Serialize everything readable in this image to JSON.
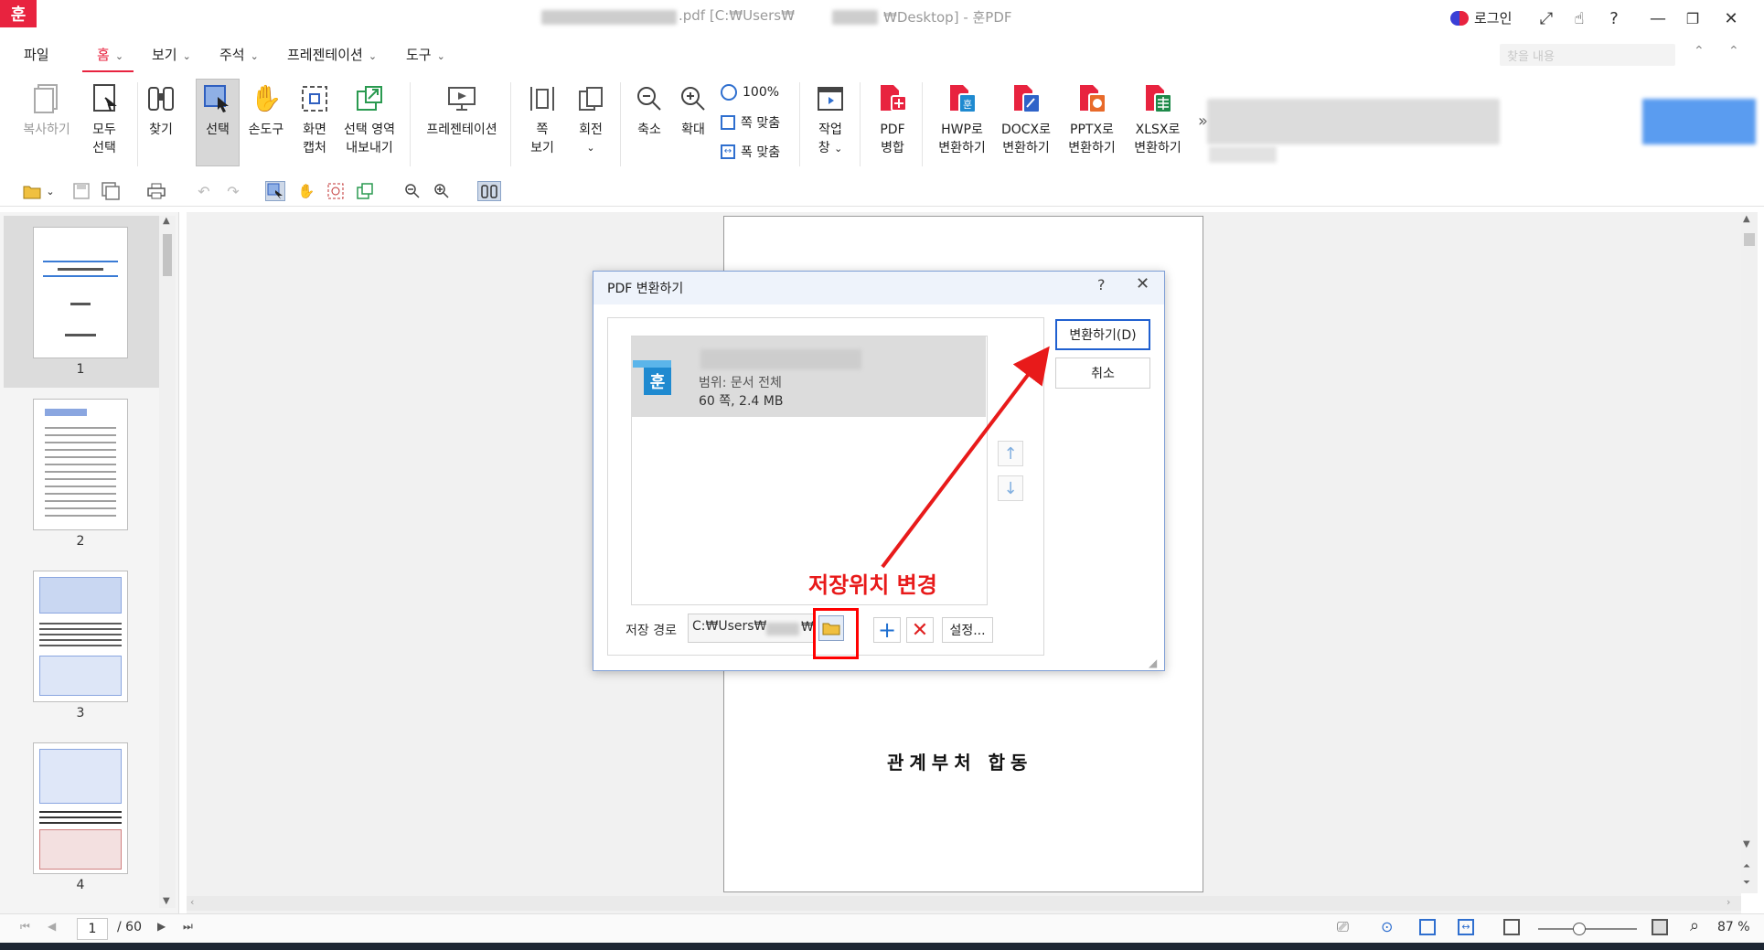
{
  "titlebar": {
    "logo": "훈",
    "file_suffix": ".pdf",
    "path_part1": "[C:₩Users₩",
    "path_part2": "₩Desktop]",
    "app_sep": " - ",
    "app_name": "훈PDF",
    "login": "로그인"
  },
  "menu": {
    "file": "파일",
    "home": "홈",
    "view": "보기",
    "annotation": "주석",
    "presentation": "프레젠테이션",
    "tools": "도구",
    "search_placeholder": "찾을 내용"
  },
  "ribbon": {
    "copy": "복사하기",
    "select_all_1": "모두",
    "select_all_2": "선택",
    "find": "찾기",
    "select": "선택",
    "hand": "손도구",
    "capture_1": "화면",
    "capture_2": "캡처",
    "export_1": "선택 영역",
    "export_2": "내보내기",
    "presentation": "프레젠테이션",
    "page_view_1": "쪽",
    "page_view_2": "보기",
    "rotate": "회전",
    "zoom_out": "축소",
    "zoom_in": "확대",
    "zoom_100": "100%",
    "fit_page": "쪽 맞춤",
    "fit_width": "폭 맞춤",
    "task_1": "작업",
    "task_2": "창",
    "pdf_merge_1": "PDF",
    "pdf_merge_2": "병합",
    "to_hwp_1": "HWP로",
    "to_hwp_2": "변환하기",
    "to_docx_1": "DOCX로",
    "to_docx_2": "변환하기",
    "to_pptx_1": "PPTX로",
    "to_pptx_2": "변환하기",
    "to_xlsx_1": "XLSX로",
    "to_xlsx_2": "변환하기",
    "more": "»"
  },
  "thumbnails": [
    "1",
    "2",
    "3",
    "4"
  ],
  "document": {
    "page_text": "관계부처 합동"
  },
  "status": {
    "current_page": "1",
    "total_pages": "/ 60",
    "zoom": "87 %"
  },
  "dialog": {
    "title": "PDF 변환하기",
    "help": "?",
    "close": "✕",
    "file_range": "범위: 문서 전체",
    "file_size": "60 쪽, 2.4 MB",
    "file_icon": "훈",
    "path_label": "저장 경로",
    "path_value": "C:₩Users₩",
    "path_tail": "₩",
    "settings": "설정...",
    "convert": "변환하기(D)",
    "cancel": "취소"
  },
  "annotation": {
    "text": "저장위치 변경",
    "color": "#e81a1a"
  },
  "colors": {
    "accent": "#e8233f",
    "dialog_border": "#7f9fd6",
    "primary_button_border": "#2060d0"
  }
}
